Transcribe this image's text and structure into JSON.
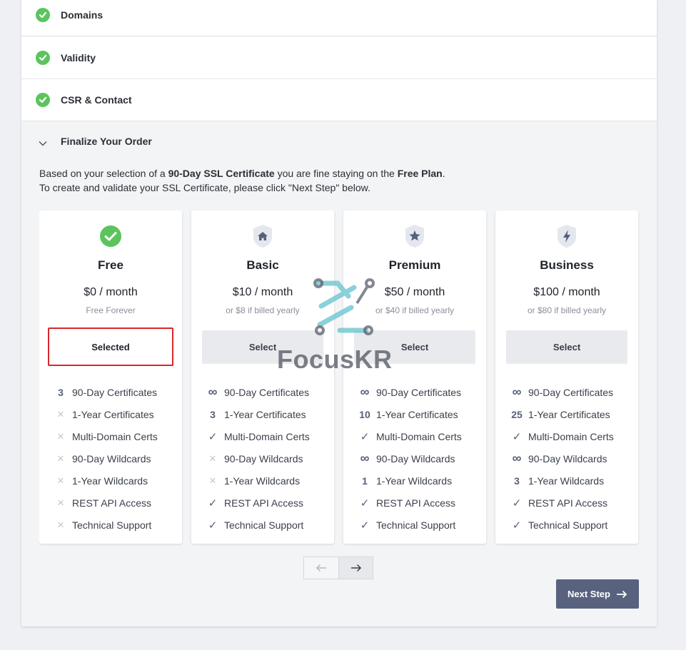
{
  "steps": [
    {
      "label": "Domains"
    },
    {
      "label": "Validity"
    },
    {
      "label": "CSR & Contact"
    }
  ],
  "finalize": {
    "title": "Finalize Your Order",
    "intro_line1_a": "Based on your selection of a ",
    "intro_line1_b": "90-Day SSL Certificate",
    "intro_line1_c": " you are fine staying on the ",
    "intro_line1_d": "Free Plan",
    "intro_line1_e": ".",
    "intro_line2": "To create and validate your SSL Certificate, please click \"Next Step\" below."
  },
  "plans": [
    {
      "name": "Free",
      "price": "$0 / month",
      "sub": "Free Forever",
      "button": "Selected",
      "icon": "check-circle-icon",
      "features": [
        {
          "mark": "3",
          "label": "90-Day Certificates"
        },
        {
          "mark": "×",
          "label": "1-Year Certificates"
        },
        {
          "mark": "×",
          "label": "Multi-Domain Certs"
        },
        {
          "mark": "×",
          "label": "90-Day Wildcards"
        },
        {
          "mark": "×",
          "label": "1-Year Wildcards"
        },
        {
          "mark": "×",
          "label": "REST API Access"
        },
        {
          "mark": "×",
          "label": "Technical Support"
        }
      ]
    },
    {
      "name": "Basic",
      "price": "$10 / month",
      "sub": "or $8 if billed yearly",
      "button": "Select",
      "icon": "home-shield-icon",
      "features": [
        {
          "mark": "∞",
          "label": "90-Day Certificates"
        },
        {
          "mark": "3",
          "label": "1-Year Certificates"
        },
        {
          "mark": "✓",
          "label": "Multi-Domain Certs"
        },
        {
          "mark": "×",
          "label": "90-Day Wildcards"
        },
        {
          "mark": "×",
          "label": "1-Year Wildcards"
        },
        {
          "mark": "✓",
          "label": "REST API Access"
        },
        {
          "mark": "✓",
          "label": "Technical Support"
        }
      ]
    },
    {
      "name": "Premium",
      "price": "$50 / month",
      "sub": "or $40 if billed yearly",
      "button": "Select",
      "icon": "star-shield-icon",
      "features": [
        {
          "mark": "∞",
          "label": "90-Day Certificates"
        },
        {
          "mark": "10",
          "label": "1-Year Certificates"
        },
        {
          "mark": "✓",
          "label": "Multi-Domain Certs"
        },
        {
          "mark": "∞",
          "label": "90-Day Wildcards"
        },
        {
          "mark": "1",
          "label": "1-Year Wildcards"
        },
        {
          "mark": "✓",
          "label": "REST API Access"
        },
        {
          "mark": "✓",
          "label": "Technical Support"
        }
      ]
    },
    {
      "name": "Business",
      "price": "$100 / month",
      "sub": "or $80 if billed yearly",
      "button": "Select",
      "icon": "bolt-shield-icon",
      "features": [
        {
          "mark": "∞",
          "label": "90-Day Certificates"
        },
        {
          "mark": "25",
          "label": "1-Year Certificates"
        },
        {
          "mark": "✓",
          "label": "Multi-Domain Certs"
        },
        {
          "mark": "∞",
          "label": "90-Day Wildcards"
        },
        {
          "mark": "3",
          "label": "1-Year Wildcards"
        },
        {
          "mark": "✓",
          "label": "REST API Access"
        },
        {
          "mark": "✓",
          "label": "Technical Support"
        }
      ]
    }
  ],
  "pager": {
    "prev_icon": "arrow-left-icon",
    "next_icon": "arrow-right-icon"
  },
  "next_step": {
    "label": "Next Step"
  },
  "watermark": {
    "text": "FocusKR"
  },
  "colors": {
    "check_green": "#5cc45e",
    "accent": "#58627f",
    "selected_border": "#d9262c",
    "cross": "#c2c6ce"
  }
}
